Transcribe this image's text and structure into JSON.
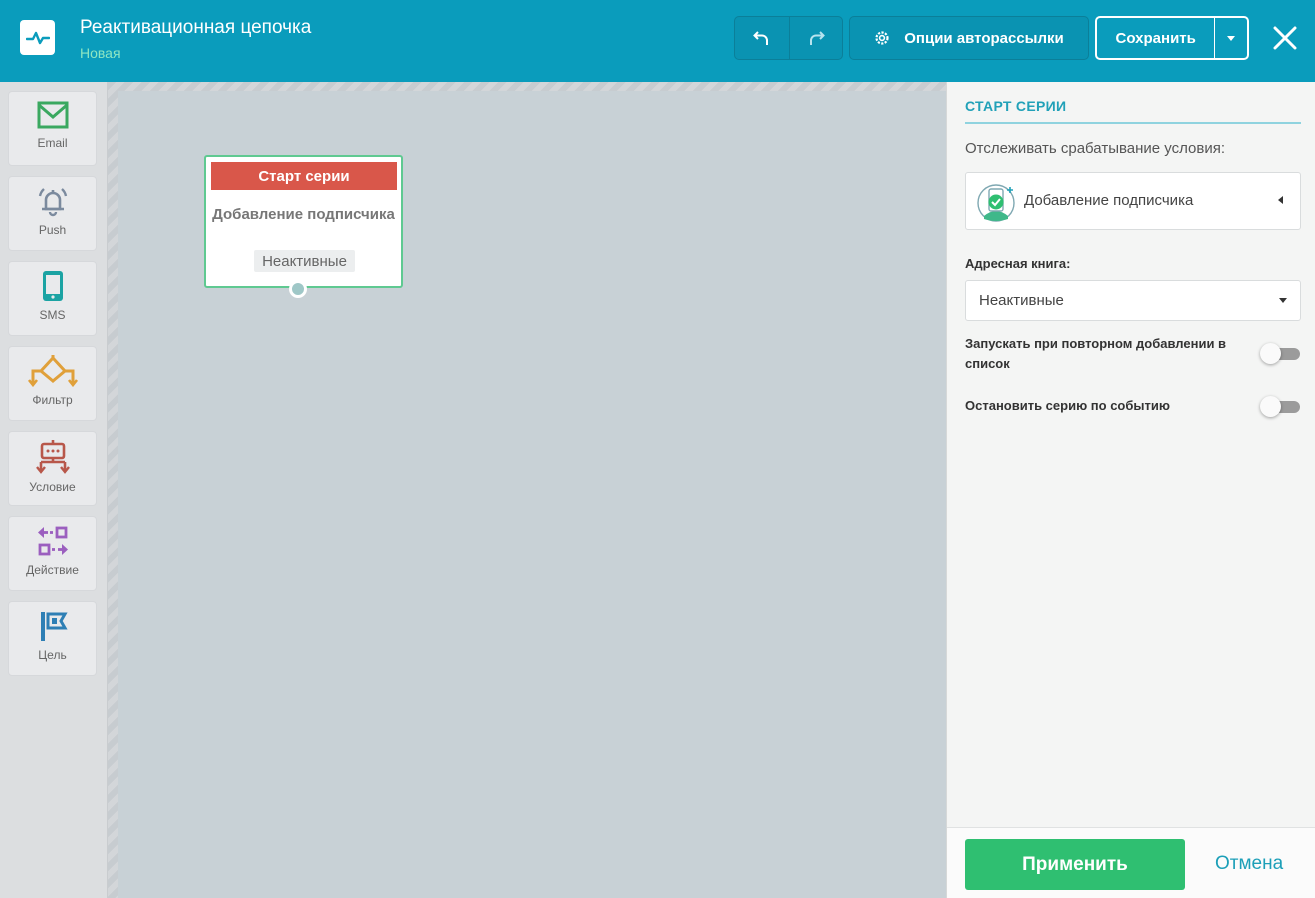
{
  "header": {
    "title": "Реактивационная цепочка",
    "status": "Новая",
    "options_label": "Опции авторассылки",
    "save_label": "Сохранить"
  },
  "palette": {
    "items": [
      {
        "label": "Email",
        "icon": "email-icon",
        "color": "#3aa860"
      },
      {
        "label": "Push",
        "icon": "bell-icon",
        "color": "#7b8a9e"
      },
      {
        "label": "SMS",
        "icon": "mobile-icon",
        "color": "#1ba3a3"
      },
      {
        "label": "Фильтр",
        "icon": "filter-icon",
        "color": "#e0a03a"
      },
      {
        "label": "Условие",
        "icon": "condition-icon",
        "color": "#b8574a"
      },
      {
        "label": "Действие",
        "icon": "action-icon",
        "color": "#9b5fbf"
      },
      {
        "label": "Цель",
        "icon": "flag-icon",
        "color": "#2e7fb5"
      }
    ]
  },
  "canvas": {
    "node": {
      "header": "Старт серии",
      "title": "Добавление подписчика",
      "badge": "Неактивные"
    }
  },
  "panel": {
    "title": "СТАРТ СЕРИИ",
    "track_label": "Отслеживать срабатывание условия:",
    "condition_value": "Добавление подписчика",
    "address_book_label": "Адресная книга:",
    "address_book_value": "Неактивные",
    "option_repeat": "Запускать при повторном добавлении в список",
    "option_stop": "Остановить серию по событию",
    "apply_label": "Применить",
    "cancel_label": "Отмена"
  },
  "colors": {
    "header_bg": "#0a9cbc",
    "accent_green": "#2fbf71",
    "node_head": "#d9574a"
  }
}
